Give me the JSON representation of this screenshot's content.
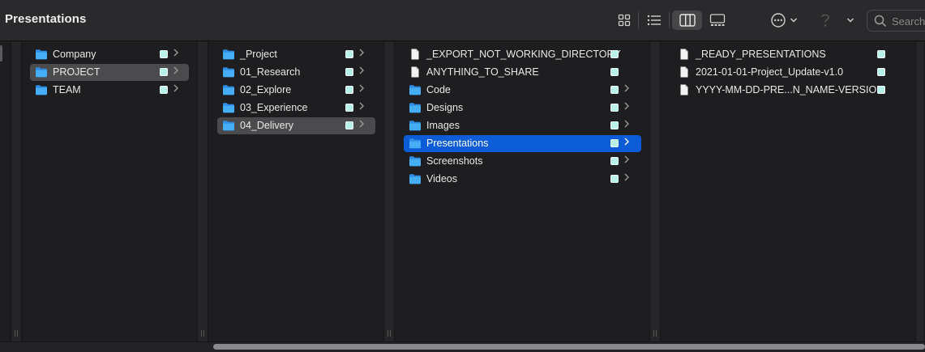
{
  "window": {
    "title": "Presentations"
  },
  "toolbar": {
    "views": [
      {
        "name": "icon-view-button",
        "icon": "grid-icon",
        "active": false
      },
      {
        "name": "list-view-button",
        "icon": "list-icon",
        "active": false
      },
      {
        "name": "column-view-button",
        "icon": "columns-icon",
        "active": true
      },
      {
        "name": "gallery-view-button",
        "icon": "gallery-icon",
        "active": false
      }
    ],
    "action_icon": "ellipsis-circle-icon",
    "share_icon": "question-icon",
    "search": {
      "placeholder": "Search"
    }
  },
  "colors": {
    "selection_blue": "#0b5cd6",
    "selection_gray": "#4b4b4e",
    "folder": "#3aa4f5",
    "tag": "#b8f0ea"
  },
  "columns": [
    {
      "items": [
        {
          "label": "Company",
          "type": "folder",
          "has_children": true
        },
        {
          "label": "PROJECT",
          "type": "folder",
          "has_children": true,
          "selected": "gray"
        },
        {
          "label": "TEAM",
          "type": "folder",
          "has_children": true
        }
      ]
    },
    {
      "items": [
        {
          "label": "_Project",
          "type": "folder",
          "has_children": true
        },
        {
          "label": "01_Research",
          "type": "folder",
          "has_children": true
        },
        {
          "label": "02_Explore",
          "type": "folder",
          "has_children": true
        },
        {
          "label": "03_Experience",
          "type": "folder",
          "has_children": true
        },
        {
          "label": "04_Delivery",
          "type": "folder",
          "has_children": true,
          "selected": "gray"
        }
      ]
    },
    {
      "items": [
        {
          "label": "_EXPORT_NOT_WORKING_DIRECTORY",
          "type": "file",
          "has_children": false
        },
        {
          "label": "ANYTHING_TO_SHARE",
          "type": "file",
          "has_children": false
        },
        {
          "label": "Code",
          "type": "folder",
          "has_children": true
        },
        {
          "label": "Designs",
          "type": "folder",
          "has_children": true
        },
        {
          "label": "Images",
          "type": "folder",
          "has_children": true
        },
        {
          "label": "Presentations",
          "type": "folder",
          "has_children": true,
          "selected": "blue"
        },
        {
          "label": "Screenshots",
          "type": "folder",
          "has_children": true
        },
        {
          "label": "Videos",
          "type": "folder",
          "has_children": true
        }
      ]
    },
    {
      "items": [
        {
          "label": "_READY_PRESENTATIONS",
          "type": "file",
          "has_children": false
        },
        {
          "label": "2021-01-01-Project_Update-v1.0",
          "type": "file",
          "has_children": false
        },
        {
          "label": "YYYY-MM-DD-PRE...N_NAME-VERSION",
          "type": "file",
          "has_children": false
        }
      ]
    }
  ]
}
